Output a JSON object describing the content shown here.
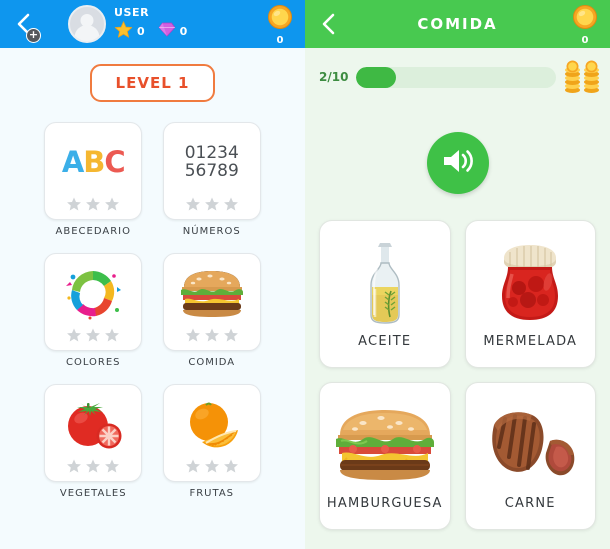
{
  "left": {
    "header": {
      "back_icon": "chevron-left-icon",
      "avatar_icon": "avatar-icon",
      "avatar_badge": "+",
      "user_name": "USER",
      "star_icon": "star-icon",
      "star_value": "0",
      "diamond_icon": "diamond-icon",
      "diamond_value": "0",
      "coin_icon": "coin-icon",
      "coin_value": "0",
      "bg_color": "#0E96EE"
    },
    "level_badge": "LEVEL 1",
    "level_badge_border_color": "#F07B3F",
    "level_badge_text_color": "#E8502B",
    "categories": [
      {
        "label": "ABECEDARIO",
        "art": "abc-letters",
        "stars_filled": 0,
        "stars_total": 3
      },
      {
        "label": "NÚMEROS",
        "art": "digits",
        "digits_line1": "01234",
        "digits_line2": "56789",
        "stars_filled": 0,
        "stars_total": 3
      },
      {
        "label": "COLORES",
        "art": "paint-splash-ring",
        "stars_filled": 0,
        "stars_total": 3
      },
      {
        "label": "COMIDA",
        "art": "hamburger",
        "stars_filled": 0,
        "stars_total": 3
      },
      {
        "label": "VEGETALES",
        "art": "tomato",
        "stars_filled": 0,
        "stars_total": 3
      },
      {
        "label": "FRUTAS",
        "art": "orange",
        "stars_filled": 0,
        "stars_total": 3
      }
    ],
    "abc_letters": {
      "a": "A",
      "b": "B",
      "c": "C",
      "a_color": "#3BAFE8",
      "b_color": "#F5B731",
      "c_color": "#EC5A52"
    }
  },
  "right": {
    "header": {
      "back_icon": "chevron-left-icon",
      "title": "COMIDA",
      "coin_icon": "coin-icon",
      "coin_value": "0",
      "bg_color": "#48C950"
    },
    "progress": {
      "label": "2/10",
      "current": 2,
      "total": 10,
      "percent": 20,
      "fill_color": "#3FB944",
      "track_color": "#DCEFDC",
      "coin_stack_icon": "coin-stack-icon"
    },
    "speaker_button": {
      "icon": "speaker-icon",
      "color": "#3FC147"
    },
    "answers": [
      {
        "label": "ACEITE",
        "art": "oil-bottle"
      },
      {
        "label": "MERMELADA",
        "art": "jam-jar"
      },
      {
        "label": "HAMBURGUESA",
        "art": "hamburger"
      },
      {
        "label": "CARNE",
        "art": "steak"
      }
    ]
  }
}
